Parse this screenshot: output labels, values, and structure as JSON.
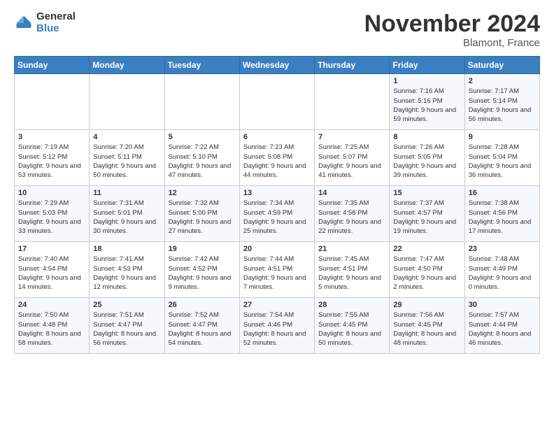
{
  "logo": {
    "general": "General",
    "blue": "Blue"
  },
  "header": {
    "month": "November 2024",
    "location": "Blamont, France"
  },
  "weekdays": [
    "Sunday",
    "Monday",
    "Tuesday",
    "Wednesday",
    "Thursday",
    "Friday",
    "Saturday"
  ],
  "weeks": [
    [
      {
        "day": "",
        "info": ""
      },
      {
        "day": "",
        "info": ""
      },
      {
        "day": "",
        "info": ""
      },
      {
        "day": "",
        "info": ""
      },
      {
        "day": "",
        "info": ""
      },
      {
        "day": "1",
        "info": "Sunrise: 7:16 AM\nSunset: 5:16 PM\nDaylight: 9 hours and 59 minutes."
      },
      {
        "day": "2",
        "info": "Sunrise: 7:17 AM\nSunset: 5:14 PM\nDaylight: 9 hours and 56 minutes."
      }
    ],
    [
      {
        "day": "3",
        "info": "Sunrise: 7:19 AM\nSunset: 5:12 PM\nDaylight: 9 hours and 53 minutes."
      },
      {
        "day": "4",
        "info": "Sunrise: 7:20 AM\nSunset: 5:11 PM\nDaylight: 9 hours and 50 minutes."
      },
      {
        "day": "5",
        "info": "Sunrise: 7:22 AM\nSunset: 5:10 PM\nDaylight: 9 hours and 47 minutes."
      },
      {
        "day": "6",
        "info": "Sunrise: 7:23 AM\nSunset: 5:08 PM\nDaylight: 9 hours and 44 minutes."
      },
      {
        "day": "7",
        "info": "Sunrise: 7:25 AM\nSunset: 5:07 PM\nDaylight: 9 hours and 41 minutes."
      },
      {
        "day": "8",
        "info": "Sunrise: 7:26 AM\nSunset: 5:05 PM\nDaylight: 9 hours and 39 minutes."
      },
      {
        "day": "9",
        "info": "Sunrise: 7:28 AM\nSunset: 5:04 PM\nDaylight: 9 hours and 36 minutes."
      }
    ],
    [
      {
        "day": "10",
        "info": "Sunrise: 7:29 AM\nSunset: 5:03 PM\nDaylight: 9 hours and 33 minutes."
      },
      {
        "day": "11",
        "info": "Sunrise: 7:31 AM\nSunset: 5:01 PM\nDaylight: 9 hours and 30 minutes."
      },
      {
        "day": "12",
        "info": "Sunrise: 7:32 AM\nSunset: 5:00 PM\nDaylight: 9 hours and 27 minutes."
      },
      {
        "day": "13",
        "info": "Sunrise: 7:34 AM\nSunset: 4:59 PM\nDaylight: 9 hours and 25 minutes."
      },
      {
        "day": "14",
        "info": "Sunrise: 7:35 AM\nSunset: 4:58 PM\nDaylight: 9 hours and 22 minutes."
      },
      {
        "day": "15",
        "info": "Sunrise: 7:37 AM\nSunset: 4:57 PM\nDaylight: 9 hours and 19 minutes."
      },
      {
        "day": "16",
        "info": "Sunrise: 7:38 AM\nSunset: 4:56 PM\nDaylight: 9 hours and 17 minutes."
      }
    ],
    [
      {
        "day": "17",
        "info": "Sunrise: 7:40 AM\nSunset: 4:54 PM\nDaylight: 9 hours and 14 minutes."
      },
      {
        "day": "18",
        "info": "Sunrise: 7:41 AM\nSunset: 4:53 PM\nDaylight: 9 hours and 12 minutes."
      },
      {
        "day": "19",
        "info": "Sunrise: 7:42 AM\nSunset: 4:52 PM\nDaylight: 9 hours and 9 minutes."
      },
      {
        "day": "20",
        "info": "Sunrise: 7:44 AM\nSunset: 4:51 PM\nDaylight: 9 hours and 7 minutes."
      },
      {
        "day": "21",
        "info": "Sunrise: 7:45 AM\nSunset: 4:51 PM\nDaylight: 9 hours and 5 minutes."
      },
      {
        "day": "22",
        "info": "Sunrise: 7:47 AM\nSunset: 4:50 PM\nDaylight: 9 hours and 2 minutes."
      },
      {
        "day": "23",
        "info": "Sunrise: 7:48 AM\nSunset: 4:49 PM\nDaylight: 9 hours and 0 minutes."
      }
    ],
    [
      {
        "day": "24",
        "info": "Sunrise: 7:50 AM\nSunset: 4:48 PM\nDaylight: 8 hours and 58 minutes."
      },
      {
        "day": "25",
        "info": "Sunrise: 7:51 AM\nSunset: 4:47 PM\nDaylight: 8 hours and 56 minutes."
      },
      {
        "day": "26",
        "info": "Sunrise: 7:52 AM\nSunset: 4:47 PM\nDaylight: 8 hours and 54 minutes."
      },
      {
        "day": "27",
        "info": "Sunrise: 7:54 AM\nSunset: 4:46 PM\nDaylight: 8 hours and 52 minutes."
      },
      {
        "day": "28",
        "info": "Sunrise: 7:55 AM\nSunset: 4:45 PM\nDaylight: 8 hours and 50 minutes."
      },
      {
        "day": "29",
        "info": "Sunrise: 7:56 AM\nSunset: 4:45 PM\nDaylight: 8 hours and 48 minutes."
      },
      {
        "day": "30",
        "info": "Sunrise: 7:57 AM\nSunset: 4:44 PM\nDaylight: 8 hours and 46 minutes."
      }
    ]
  ]
}
